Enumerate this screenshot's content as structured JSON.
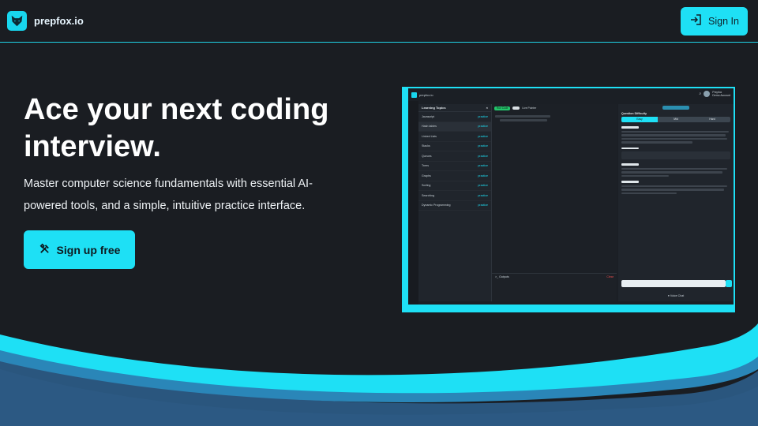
{
  "header": {
    "brand": "prepfox.io",
    "signin_label": "Sign In"
  },
  "hero": {
    "title": "Ace your next coding interview.",
    "subtitle": "Master computer science fundamentals with essential AI-powered tools, and a simple, intuitive practice interface.",
    "cta_label": "Sign up free"
  },
  "preview": {
    "brand": "prepfox.io",
    "user_name": "Prepfox",
    "user_sub": "Demo Account",
    "sidebar_title": "Learning Topics",
    "practice_label": "practice",
    "topics": [
      "Javascript",
      "Hash tables",
      "Linked Lists",
      "Stacks",
      "Queues",
      "Trees",
      "Graphs",
      "Sorting",
      "Searching",
      "Dynamic Programming"
    ],
    "toolbar_run": "Run Code",
    "toolbar_toggle": "Live Pointer",
    "output_label": ">_ Outputs",
    "output_clear": "Clear",
    "generate_label": "Generate Question",
    "difficulty_label": "Question Difficulty",
    "difficulties": [
      "Easy",
      "Mid",
      "Hard"
    ],
    "selected_difficulty": "Easy",
    "sections": [
      "Question:",
      "Example:",
      "Explanation:",
      "Requirements:"
    ],
    "voice_label": "Voice Chat"
  },
  "colors": {
    "background": "#1a1d22",
    "accent": "#1ee0f5",
    "wave_dark": "#2c5d88",
    "wave_mid": "#2a86b8"
  },
  "icons": {
    "logo": "fox-icon",
    "signin": "login-icon",
    "cta": "tools-icon"
  }
}
